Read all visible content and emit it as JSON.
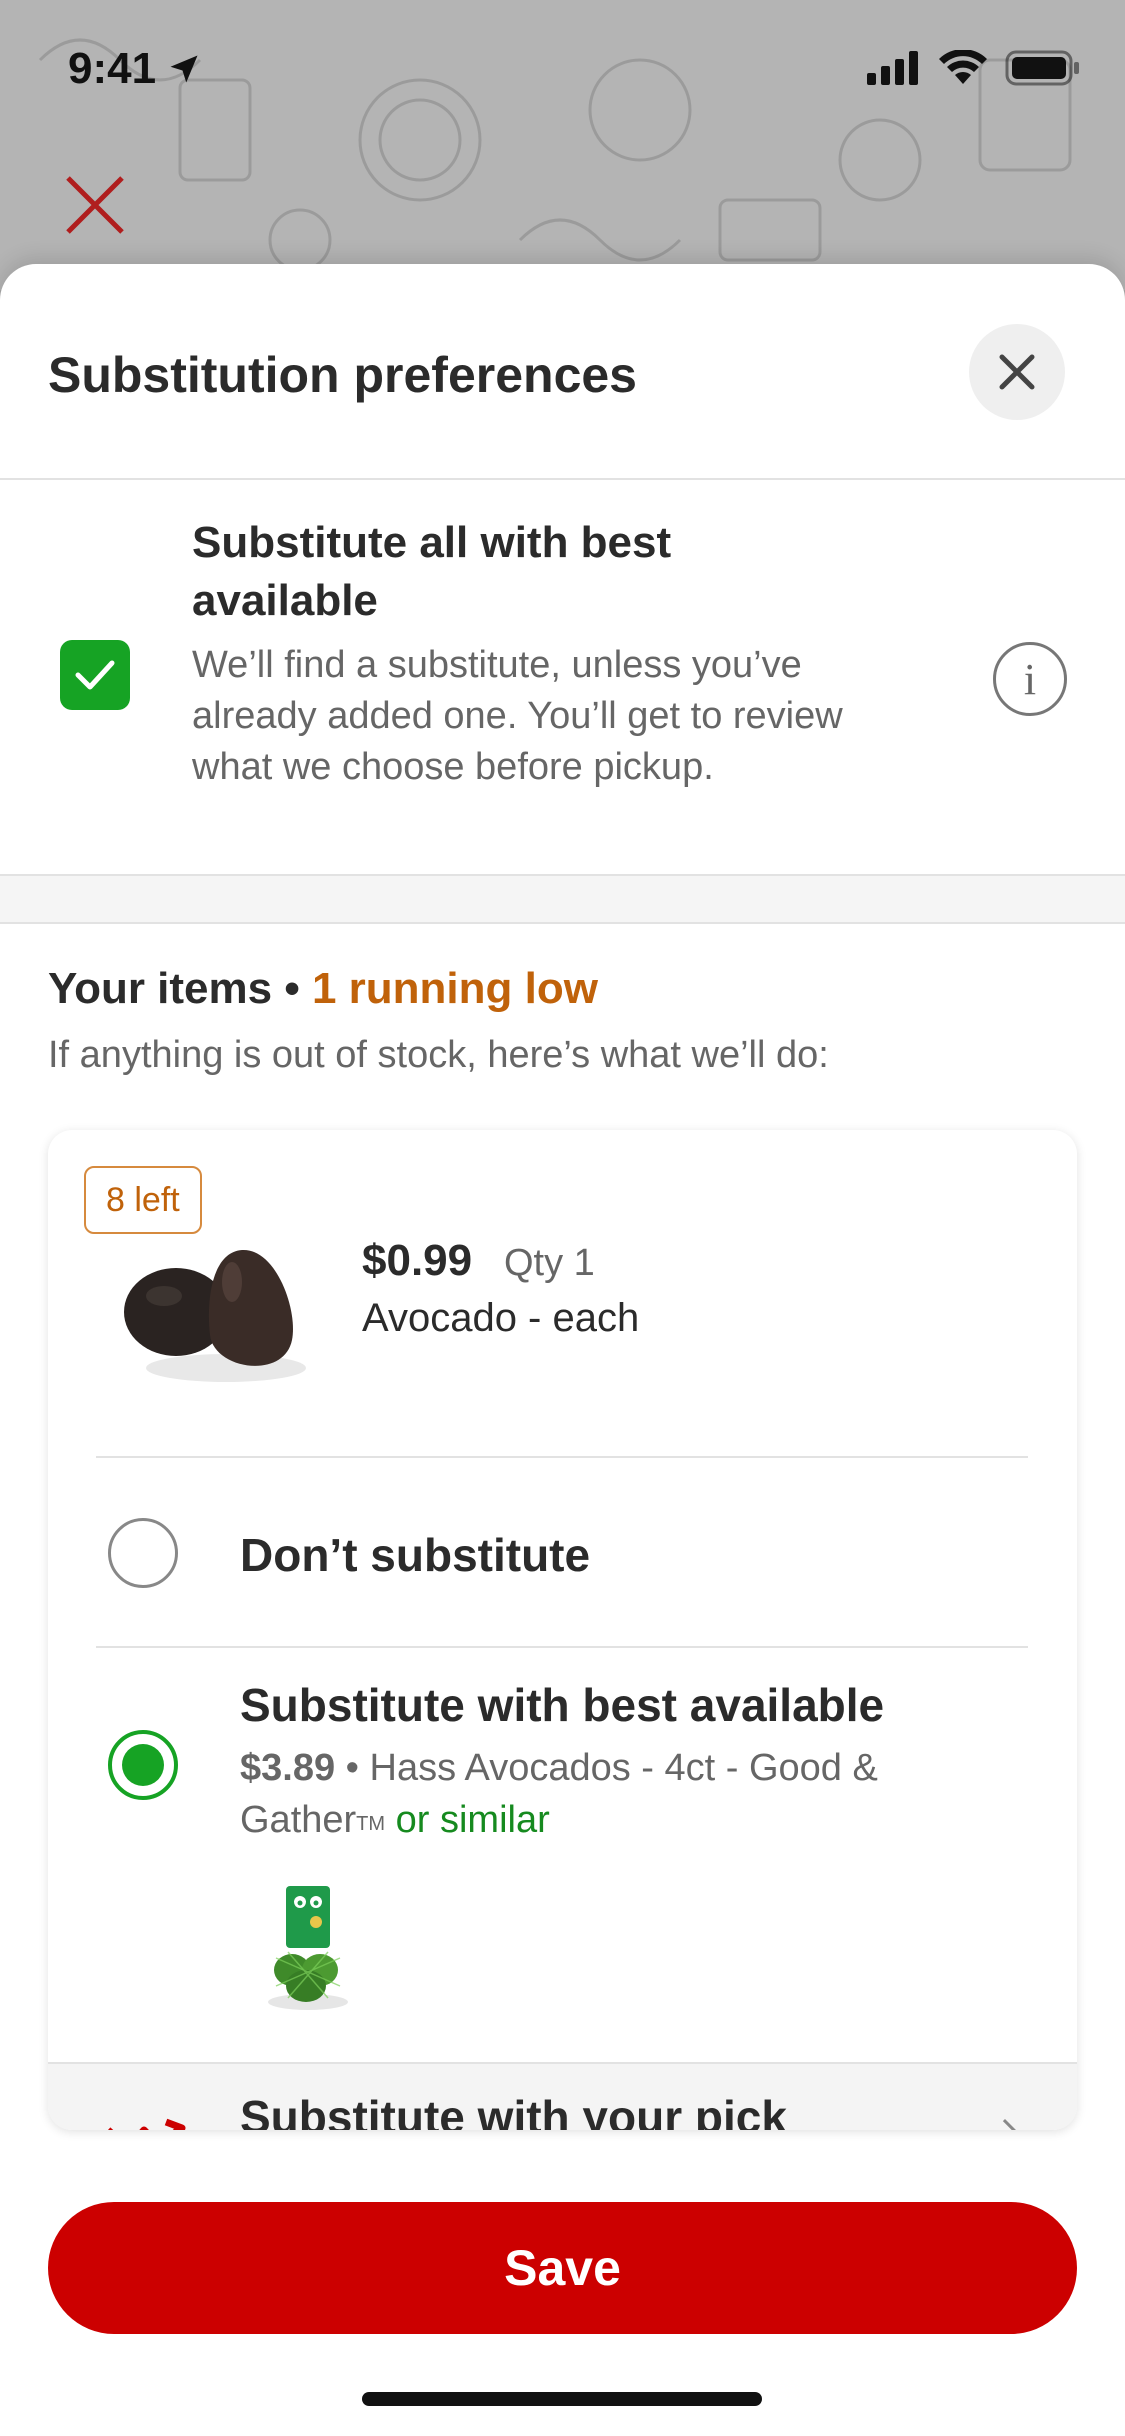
{
  "status_bar": {
    "time": "9:41",
    "icons": [
      "location-arrow-icon",
      "signal-icon",
      "wifi-icon",
      "battery-icon"
    ]
  },
  "background": {
    "close_icon": "close-icon"
  },
  "sheet": {
    "title": "Substitution preferences",
    "close_icon": "close-icon"
  },
  "substitute_all": {
    "checked": true,
    "title": "Substitute all with best available",
    "description": "We’ll find a substitute, unless you’ve already added one. You’ll get to review what we choose before pickup.",
    "info_icon": "info-icon"
  },
  "items": {
    "title": "Your items",
    "separator": " • ",
    "running_low": "1 running low",
    "subtitle": "If anything is out of stock, here’s what we’ll do:"
  },
  "product": {
    "stock_badge": "8 left",
    "price": "$0.99",
    "qty": "Qty 1",
    "name": "Avocado - each"
  },
  "options": {
    "dont_substitute": "Don’t substitute",
    "best_available": {
      "label": "Substitute with best available",
      "price": "$3.89",
      "separator": " • ",
      "name": "Hass Avocados - 4ct - Good & Gather",
      "trademark": "TM",
      "similar": " or similar",
      "selected": true
    },
    "your_pick": "Substitute with your pick"
  },
  "footer": {
    "save_label": "Save"
  },
  "colors": {
    "brand_red": "#cc0000",
    "check_green": "#16a324",
    "low_stock_orange": "#c0620a"
  }
}
